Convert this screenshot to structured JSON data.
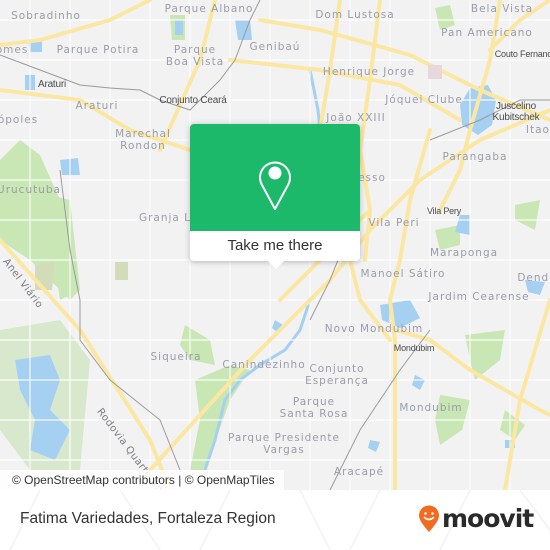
{
  "map": {
    "colors": {
      "background": "#f2f2f3",
      "major_road": "#fbe7a1",
      "minor_road": "#ffffff",
      "water": "#a6d0f1",
      "park": "#c9e7b4",
      "rail": "#9a9a9a"
    },
    "neighborhood_labels": [
      {
        "id": "sobradinho",
        "text": "Sobradinho"
      },
      {
        "id": "parque-albano",
        "text": "Parque Albano"
      },
      {
        "id": "dom-lustosa",
        "text": "Dom Lustosa"
      },
      {
        "id": "bela-vista",
        "text": "Bela Vista"
      },
      {
        "id": "pan-americano",
        "text": "Pan Americano"
      },
      {
        "id": "gomes",
        "text": "omes"
      },
      {
        "id": "parque-potira",
        "text": "Parque Potira"
      },
      {
        "id": "parque-boa-vista-1",
        "text": "Parque"
      },
      {
        "id": "parque-boa-vista-2",
        "text": "Boa Vista"
      },
      {
        "id": "genibau",
        "text": "Genibaú"
      },
      {
        "id": "henrique-jorge",
        "text": "Henrique Jorge"
      },
      {
        "id": "araturi",
        "text": "Araturi"
      },
      {
        "id": "joquei-clube",
        "text": "Jóquei Clube"
      },
      {
        "id": "polis",
        "text": "ópoles"
      },
      {
        "id": "marechal-rondon-1",
        "text": "Marechal"
      },
      {
        "id": "marechal-rondon-2",
        "text": "Rondon"
      },
      {
        "id": "joao-xxiii",
        "text": "João XXIII"
      },
      {
        "id": "itaoca",
        "text": "Itaoca"
      },
      {
        "id": "parangaba",
        "text": "Parangaba"
      },
      {
        "id": "urucutuba",
        "text": "Urucutuba"
      },
      {
        "id": "progresso",
        "text": "esso"
      },
      {
        "id": "granja-lisboa",
        "text": "Granja L"
      },
      {
        "id": "vila-peri",
        "text": "Vila Peri"
      },
      {
        "id": "maraponga",
        "text": "Maraponga"
      },
      {
        "id": "dende",
        "text": "Dendê"
      },
      {
        "id": "manoel-satiro",
        "text": "Manoel Sátiro"
      },
      {
        "id": "jardim-cearense",
        "text": "Jardim Cearense"
      },
      {
        "id": "novo-mondubim",
        "text": "Novo Mondubim"
      },
      {
        "id": "siqueira",
        "text": "Siqueira"
      },
      {
        "id": "canindezinho",
        "text": "Canindezinho"
      },
      {
        "id": "conjunto-esperanca-1",
        "text": "Conjunto"
      },
      {
        "id": "conjunto-esperanca-2",
        "text": "Esperança"
      },
      {
        "id": "parque-santa-rosa-1",
        "text": "Parque"
      },
      {
        "id": "parque-santa-rosa-2",
        "text": "Santa Rosa"
      },
      {
        "id": "mondubim",
        "text": "Mondubim"
      },
      {
        "id": "parque-presidente-vargas-1",
        "text": "Parque Presidente"
      },
      {
        "id": "parque-presidente-vargas-2",
        "text": "Vargas"
      },
      {
        "id": "aracape",
        "text": "Aracapé"
      }
    ],
    "poi_labels": [
      {
        "id": "araturi-station",
        "text": "Araturi"
      },
      {
        "id": "conjunto-ceara",
        "text": "Conjunto Ceará"
      },
      {
        "id": "couto-fernandes",
        "text": "Couto Fernandes"
      },
      {
        "id": "juscelino-kubitschek-1",
        "text": "Juscelino"
      },
      {
        "id": "juscelino-kubitschek-2",
        "text": "Kubitschek"
      },
      {
        "id": "vila-pery",
        "text": "Vila Pery"
      },
      {
        "id": "mondubim-station",
        "text": "Mondubim"
      }
    ],
    "road_labels": [
      {
        "id": "anel-viario",
        "text": "Anel Viário"
      },
      {
        "id": "rodovia-quarto-anel",
        "text": "Rodovia Quarto Anel"
      }
    ],
    "attribution": {
      "osm": "© OpenStreetMap contributors",
      "separator": " | ",
      "omt": "© OpenMapTiles"
    }
  },
  "popup": {
    "icon": "map-pin-icon",
    "action_label": "Take me there",
    "color": "#1db96a"
  },
  "footer": {
    "title": "Fatima Variedades, Fortaleza Region",
    "brand": "moovit",
    "brand_color": "#f26b21"
  }
}
